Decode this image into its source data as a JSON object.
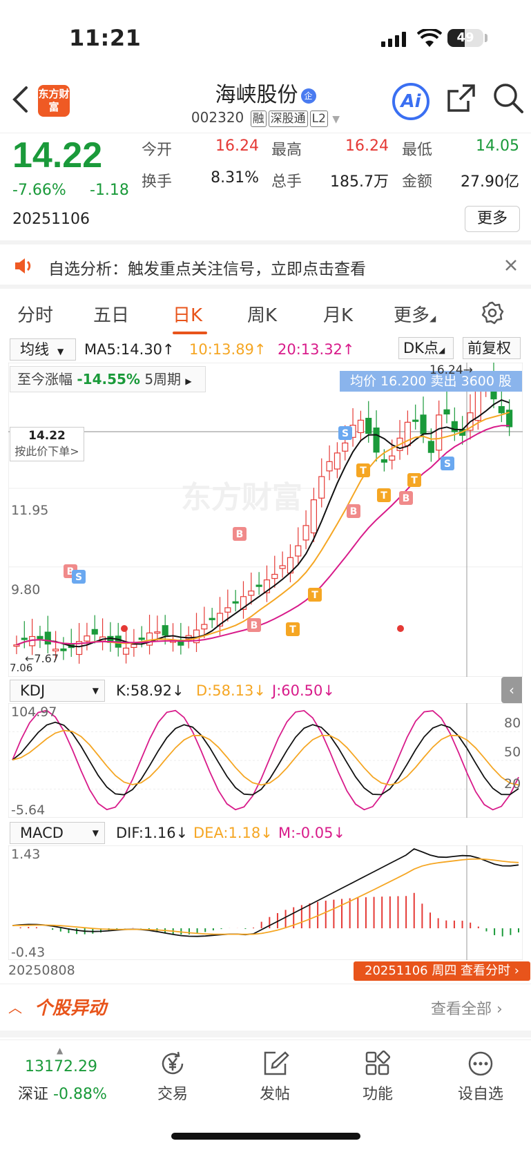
{
  "status_bar": {
    "time": "11:21",
    "battery": "49",
    "battery_level": 0.49
  },
  "header": {
    "logo_text": "东方财富",
    "stock_name": "海峡股份",
    "company_badge": "企",
    "stock_code": "002320",
    "tags": [
      "融",
      "深股通",
      "L2"
    ],
    "ai_label": "Ai"
  },
  "quote": {
    "price": "14.22",
    "change_pct": "-7.66%",
    "change": "-1.18",
    "date": "20251106",
    "open_label": "今开",
    "open": "16.24",
    "high_label": "最高",
    "high": "16.24",
    "low_label": "最低",
    "low": "14.05",
    "turnover_label": "换手",
    "turnover": "8.31%",
    "volume_label": "总手",
    "volume": "185.7万",
    "amount_label": "金额",
    "amount": "27.90亿",
    "more": "更多"
  },
  "notice": {
    "text": "自选分析：触发重点关注信号，立即点击查看"
  },
  "tabs": [
    "分时",
    "五日",
    "日K",
    "周K",
    "月K",
    "更多"
  ],
  "active_tab": "日K",
  "kline": {
    "indicator": "均线",
    "ma5": "MA5:14.30",
    "ma10": "10:13.89",
    "ma20": "20:13.32",
    "dk_label": "DK点",
    "adjust_label": "前复权",
    "range_label": "至今涨幅",
    "range_value": "-14.55%",
    "range_period": "5周期",
    "tooltip": "均价 16.200 卖出 3600 股",
    "peak_label": "16.24",
    "price_tag": "14.22",
    "order_hint": "按此价下单>",
    "axis_labels": [
      "11.95",
      "9.80"
    ],
    "low_label": "7.67",
    "low_axis": "7.06"
  },
  "kdj": {
    "name": "KDJ",
    "k": "K:58.92",
    "d": "D:58.13",
    "j": "J:60.50",
    "top": "104.97",
    "bottom": "-5.64",
    "levels": [
      "80",
      "50",
      "20"
    ]
  },
  "macd": {
    "name": "MACD",
    "dif": "DIF:1.16",
    "dea": "DEA:1.18",
    "m": "M:-0.05",
    "top": "1.43",
    "bottom": "-0.43",
    "start_date": "20250808",
    "end_info": "20251106 周四 查看分时"
  },
  "movers": {
    "title": "个股异动",
    "view_all": "查看全部"
  },
  "bottom_nav": {
    "index_value": "13172.29",
    "index_name": "深证",
    "index_change": "-0.88%",
    "items": [
      "交易",
      "发帖",
      "功能",
      "设自选"
    ]
  },
  "colors": {
    "up": "#e53935",
    "down": "#1a9a3a",
    "accent": "#e8541b",
    "ma5": "#111111",
    "ma10": "#f5a623",
    "ma20": "#d81b8a"
  }
}
